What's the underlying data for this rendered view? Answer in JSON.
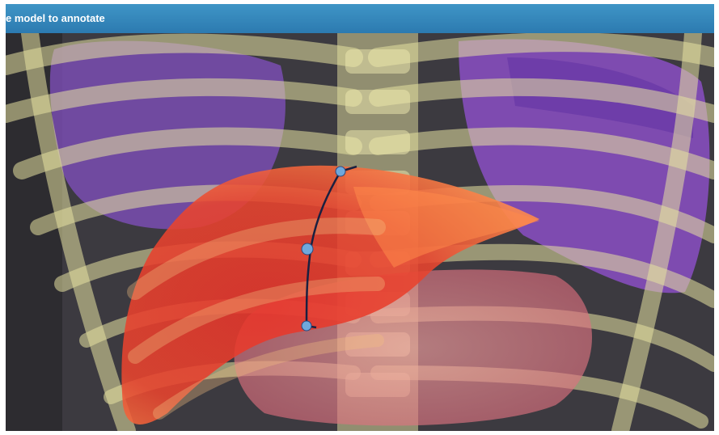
{
  "window": {
    "title": "e model to annotate"
  },
  "viewport": {
    "colors": {
      "background": "#3c3a40",
      "bone": "#e6e2a0",
      "lung": "#8a4fc4",
      "liver": "#e8342a",
      "liver_highlight": "#ff7a3a",
      "stomach": "#f08080",
      "annotation_line": "#1a2040",
      "annotation_point": "#6fa8dc"
    },
    "annotation_points": [
      "point-top",
      "point-middle",
      "point-bottom"
    ]
  }
}
